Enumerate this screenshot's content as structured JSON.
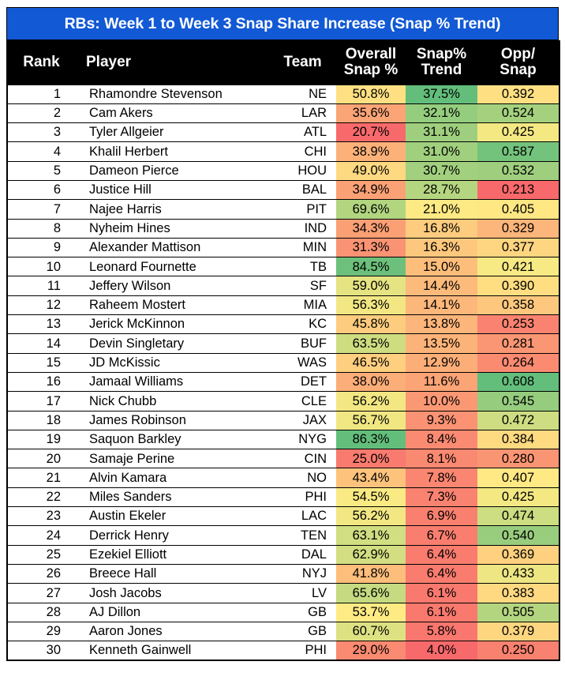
{
  "title": "RBs: Week 1 to Week 3 Snap Share Increase (Snap % Trend)",
  "theme": {
    "title_bg": "#1259D5",
    "title_fg": "#FFFFFF",
    "header_bg": "#000000",
    "header_fg": "#FFFFFF",
    "heat_low": "#F8696B",
    "heat_mid": "#FFEB84",
    "heat_high": "#63BE7B"
  },
  "columns": [
    {
      "key": "rank",
      "label": "Rank",
      "align": "center"
    },
    {
      "key": "player",
      "label": "Player",
      "align": "left"
    },
    {
      "key": "team",
      "label": "Team",
      "align": "center"
    },
    {
      "key": "snap",
      "label": "Overall\nSnap %",
      "align": "center"
    },
    {
      "key": "trend",
      "label": "Snap%\nTrend",
      "align": "center"
    },
    {
      "key": "opp",
      "label": "Opp/\nSnap",
      "align": "center"
    }
  ],
  "heat_scales": {
    "snap": {
      "min": 20.7,
      "max": 86.3
    },
    "trend": {
      "min": 4.0,
      "max": 37.5
    },
    "opp": {
      "min": 0.213,
      "max": 0.608
    }
  },
  "chart_data": {
    "type": "table",
    "title": "RBs: Week 1 to Week 3 Snap Share Increase (Snap % Trend)",
    "columns": [
      "Rank",
      "Player",
      "Team",
      "Overall Snap %",
      "Snap% Trend",
      "Opp/Snap"
    ],
    "rows": [
      {
        "rank": "1",
        "player": "Rhamondre Stevenson",
        "team": "NE",
        "snap": "50.8%",
        "trend": "37.5%",
        "opp": "0.392",
        "snap_val": 50.8,
        "trend_val": 37.5,
        "opp_val": 0.392
      },
      {
        "rank": "2",
        "player": "Cam Akers",
        "team": "LAR",
        "snap": "35.6%",
        "trend": "32.1%",
        "opp": "0.524",
        "snap_val": 35.6,
        "trend_val": 32.1,
        "opp_val": 0.524
      },
      {
        "rank": "3",
        "player": "Tyler Allgeier",
        "team": "ATL",
        "snap": "20.7%",
        "trend": "31.1%",
        "opp": "0.425",
        "snap_val": 20.7,
        "trend_val": 31.1,
        "opp_val": 0.425
      },
      {
        "rank": "4",
        "player": "Khalil Herbert",
        "team": "CHI",
        "snap": "38.9%",
        "trend": "31.0%",
        "opp": "0.587",
        "snap_val": 38.9,
        "trend_val": 31.0,
        "opp_val": 0.587
      },
      {
        "rank": "5",
        "player": "Dameon Pierce",
        "team": "HOU",
        "snap": "49.0%",
        "trend": "30.7%",
        "opp": "0.532",
        "snap_val": 49.0,
        "trend_val": 30.7,
        "opp_val": 0.532
      },
      {
        "rank": "6",
        "player": "Justice Hill",
        "team": "BAL",
        "snap": "34.9%",
        "trend": "28.7%",
        "opp": "0.213",
        "snap_val": 34.9,
        "trend_val": 28.7,
        "opp_val": 0.213
      },
      {
        "rank": "7",
        "player": "Najee Harris",
        "team": "PIT",
        "snap": "69.6%",
        "trend": "21.0%",
        "opp": "0.405",
        "snap_val": 69.6,
        "trend_val": 21.0,
        "opp_val": 0.405
      },
      {
        "rank": "8",
        "player": "Nyheim Hines",
        "team": "IND",
        "snap": "34.3%",
        "trend": "16.8%",
        "opp": "0.329",
        "snap_val": 34.3,
        "trend_val": 16.8,
        "opp_val": 0.329
      },
      {
        "rank": "9",
        "player": "Alexander Mattison",
        "team": "MIN",
        "snap": "31.3%",
        "trend": "16.3%",
        "opp": "0.377",
        "snap_val": 31.3,
        "trend_val": 16.3,
        "opp_val": 0.377
      },
      {
        "rank": "10",
        "player": "Leonard Fournette",
        "team": "TB",
        "snap": "84.5%",
        "trend": "15.0%",
        "opp": "0.421",
        "snap_val": 84.5,
        "trend_val": 15.0,
        "opp_val": 0.421
      },
      {
        "rank": "11",
        "player": "Jeffery Wilson",
        "team": "SF",
        "snap": "59.0%",
        "trend": "14.4%",
        "opp": "0.390",
        "snap_val": 59.0,
        "trend_val": 14.4,
        "opp_val": 0.39
      },
      {
        "rank": "12",
        "player": "Raheem Mostert",
        "team": "MIA",
        "snap": "56.3%",
        "trend": "14.1%",
        "opp": "0.358",
        "snap_val": 56.3,
        "trend_val": 14.1,
        "opp_val": 0.358
      },
      {
        "rank": "13",
        "player": "Jerick McKinnon",
        "team": "KC",
        "snap": "45.8%",
        "trend": "13.8%",
        "opp": "0.253",
        "snap_val": 45.8,
        "trend_val": 13.8,
        "opp_val": 0.253
      },
      {
        "rank": "14",
        "player": "Devin Singletary",
        "team": "BUF",
        "snap": "63.5%",
        "trend": "13.5%",
        "opp": "0.281",
        "snap_val": 63.5,
        "trend_val": 13.5,
        "opp_val": 0.281
      },
      {
        "rank": "15",
        "player": "JD McKissic",
        "team": "WAS",
        "snap": "46.5%",
        "trend": "12.9%",
        "opp": "0.264",
        "snap_val": 46.5,
        "trend_val": 12.9,
        "opp_val": 0.264
      },
      {
        "rank": "16",
        "player": "Jamaal Williams",
        "team": "DET",
        "snap": "38.0%",
        "trend": "11.6%",
        "opp": "0.608",
        "snap_val": 38.0,
        "trend_val": 11.6,
        "opp_val": 0.608
      },
      {
        "rank": "17",
        "player": "Nick Chubb",
        "team": "CLE",
        "snap": "56.2%",
        "trend": "10.0%",
        "opp": "0.545",
        "snap_val": 56.2,
        "trend_val": 10.0,
        "opp_val": 0.545
      },
      {
        "rank": "18",
        "player": "James Robinson",
        "team": "JAX",
        "snap": "56.7%",
        "trend": "9.3%",
        "opp": "0.472",
        "snap_val": 56.7,
        "trend_val": 9.3,
        "opp_val": 0.472
      },
      {
        "rank": "19",
        "player": "Saquon Barkley",
        "team": "NYG",
        "snap": "86.3%",
        "trend": "8.4%",
        "opp": "0.384",
        "snap_val": 86.3,
        "trend_val": 8.4,
        "opp_val": 0.384
      },
      {
        "rank": "20",
        "player": "Samaje Perine",
        "team": "CIN",
        "snap": "25.0%",
        "trend": "8.1%",
        "opp": "0.280",
        "snap_val": 25.0,
        "trend_val": 8.1,
        "opp_val": 0.28
      },
      {
        "rank": "21",
        "player": "Alvin Kamara",
        "team": "NO",
        "snap": "43.4%",
        "trend": "7.8%",
        "opp": "0.407",
        "snap_val": 43.4,
        "trend_val": 7.8,
        "opp_val": 0.407
      },
      {
        "rank": "22",
        "player": "Miles Sanders",
        "team": "PHI",
        "snap": "54.5%",
        "trend": "7.3%",
        "opp": "0.425",
        "snap_val": 54.5,
        "trend_val": 7.3,
        "opp_val": 0.425
      },
      {
        "rank": "23",
        "player": "Austin Ekeler",
        "team": "LAC",
        "snap": "56.2%",
        "trend": "6.9%",
        "opp": "0.474",
        "snap_val": 56.2,
        "trend_val": 6.9,
        "opp_val": 0.474
      },
      {
        "rank": "24",
        "player": "Derrick Henry",
        "team": "TEN",
        "snap": "63.1%",
        "trend": "6.7%",
        "opp": "0.540",
        "snap_val": 63.1,
        "trend_val": 6.7,
        "opp_val": 0.54
      },
      {
        "rank": "25",
        "player": "Ezekiel Elliott",
        "team": "DAL",
        "snap": "62.9%",
        "trend": "6.4%",
        "opp": "0.369",
        "snap_val": 62.9,
        "trend_val": 6.4,
        "opp_val": 0.369
      },
      {
        "rank": "26",
        "player": "Breece Hall",
        "team": "NYJ",
        "snap": "41.8%",
        "trend": "6.4%",
        "opp": "0.433",
        "snap_val": 41.8,
        "trend_val": 6.4,
        "opp_val": 0.433
      },
      {
        "rank": "27",
        "player": "Josh Jacobs",
        "team": "LV",
        "snap": "65.6%",
        "trend": "6.1%",
        "opp": "0.383",
        "snap_val": 65.6,
        "trend_val": 6.1,
        "opp_val": 0.383
      },
      {
        "rank": "28",
        "player": "AJ Dillon",
        "team": "GB",
        "snap": "53.7%",
        "trend": "6.1%",
        "opp": "0.505",
        "snap_val": 53.7,
        "trend_val": 6.1,
        "opp_val": 0.505
      },
      {
        "rank": "29",
        "player": "Aaron Jones",
        "team": "GB",
        "snap": "60.7%",
        "trend": "5.8%",
        "opp": "0.379",
        "snap_val": 60.7,
        "trend_val": 5.8,
        "opp_val": 0.379
      },
      {
        "rank": "30",
        "player": "Kenneth Gainwell",
        "team": "PHI",
        "snap": "29.0%",
        "trend": "4.0%",
        "opp": "0.250",
        "snap_val": 29.0,
        "trend_val": 4.0,
        "opp_val": 0.25
      }
    ]
  }
}
